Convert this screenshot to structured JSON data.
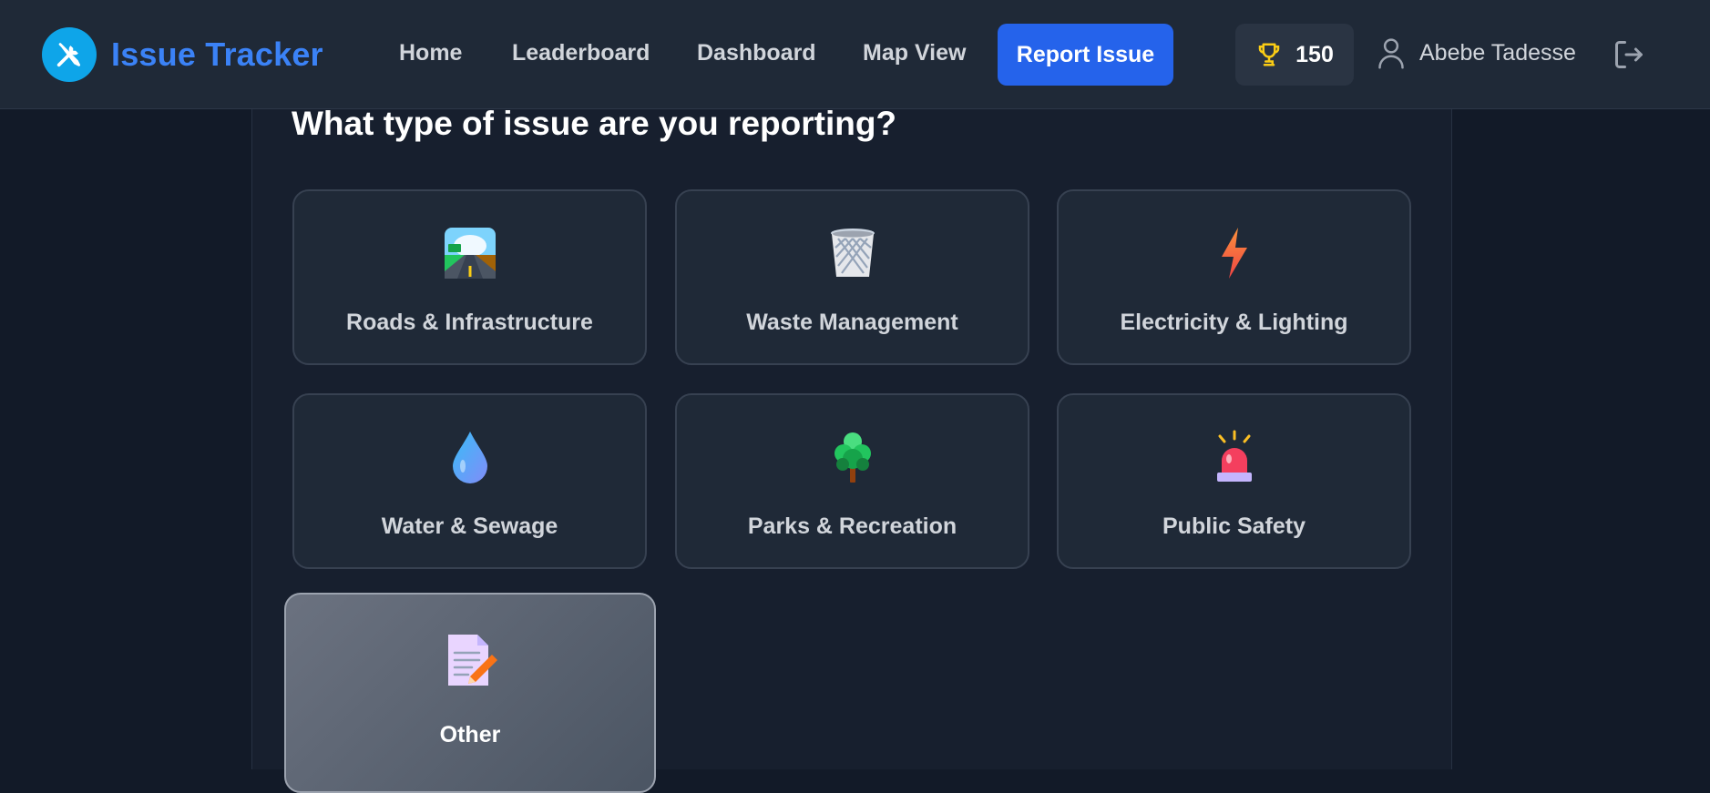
{
  "header": {
    "brand": "Issue Tracker",
    "brand_icon": "tools-icon",
    "nav": [
      "Home",
      "Leaderboard",
      "Dashboard",
      "Map View"
    ],
    "report_button": "Report Issue",
    "points": "150",
    "points_icon": "trophy-icon",
    "user_name": "Abebe Tadesse",
    "user_icon": "user-icon",
    "logout_icon": "logout-icon",
    "colors": {
      "brand": "#3b82f6",
      "primary_button": "#2563eb",
      "trophy": "#facc15"
    }
  },
  "main": {
    "question": "What type of issue are you reporting?",
    "categories": [
      {
        "label": "Roads & Infrastructure",
        "icon": "road-icon",
        "selected": false
      },
      {
        "label": "Waste Management",
        "icon": "wastebasket-icon",
        "selected": false
      },
      {
        "label": "Electricity & Lighting",
        "icon": "lightning-icon",
        "selected": false
      },
      {
        "label": "Water & Sewage",
        "icon": "water-drop-icon",
        "selected": false
      },
      {
        "label": "Parks & Recreation",
        "icon": "tree-icon",
        "selected": false
      },
      {
        "label": "Public Safety",
        "icon": "siren-icon",
        "selected": false
      },
      {
        "label": "Other",
        "icon": "memo-icon",
        "selected": true
      }
    ]
  }
}
